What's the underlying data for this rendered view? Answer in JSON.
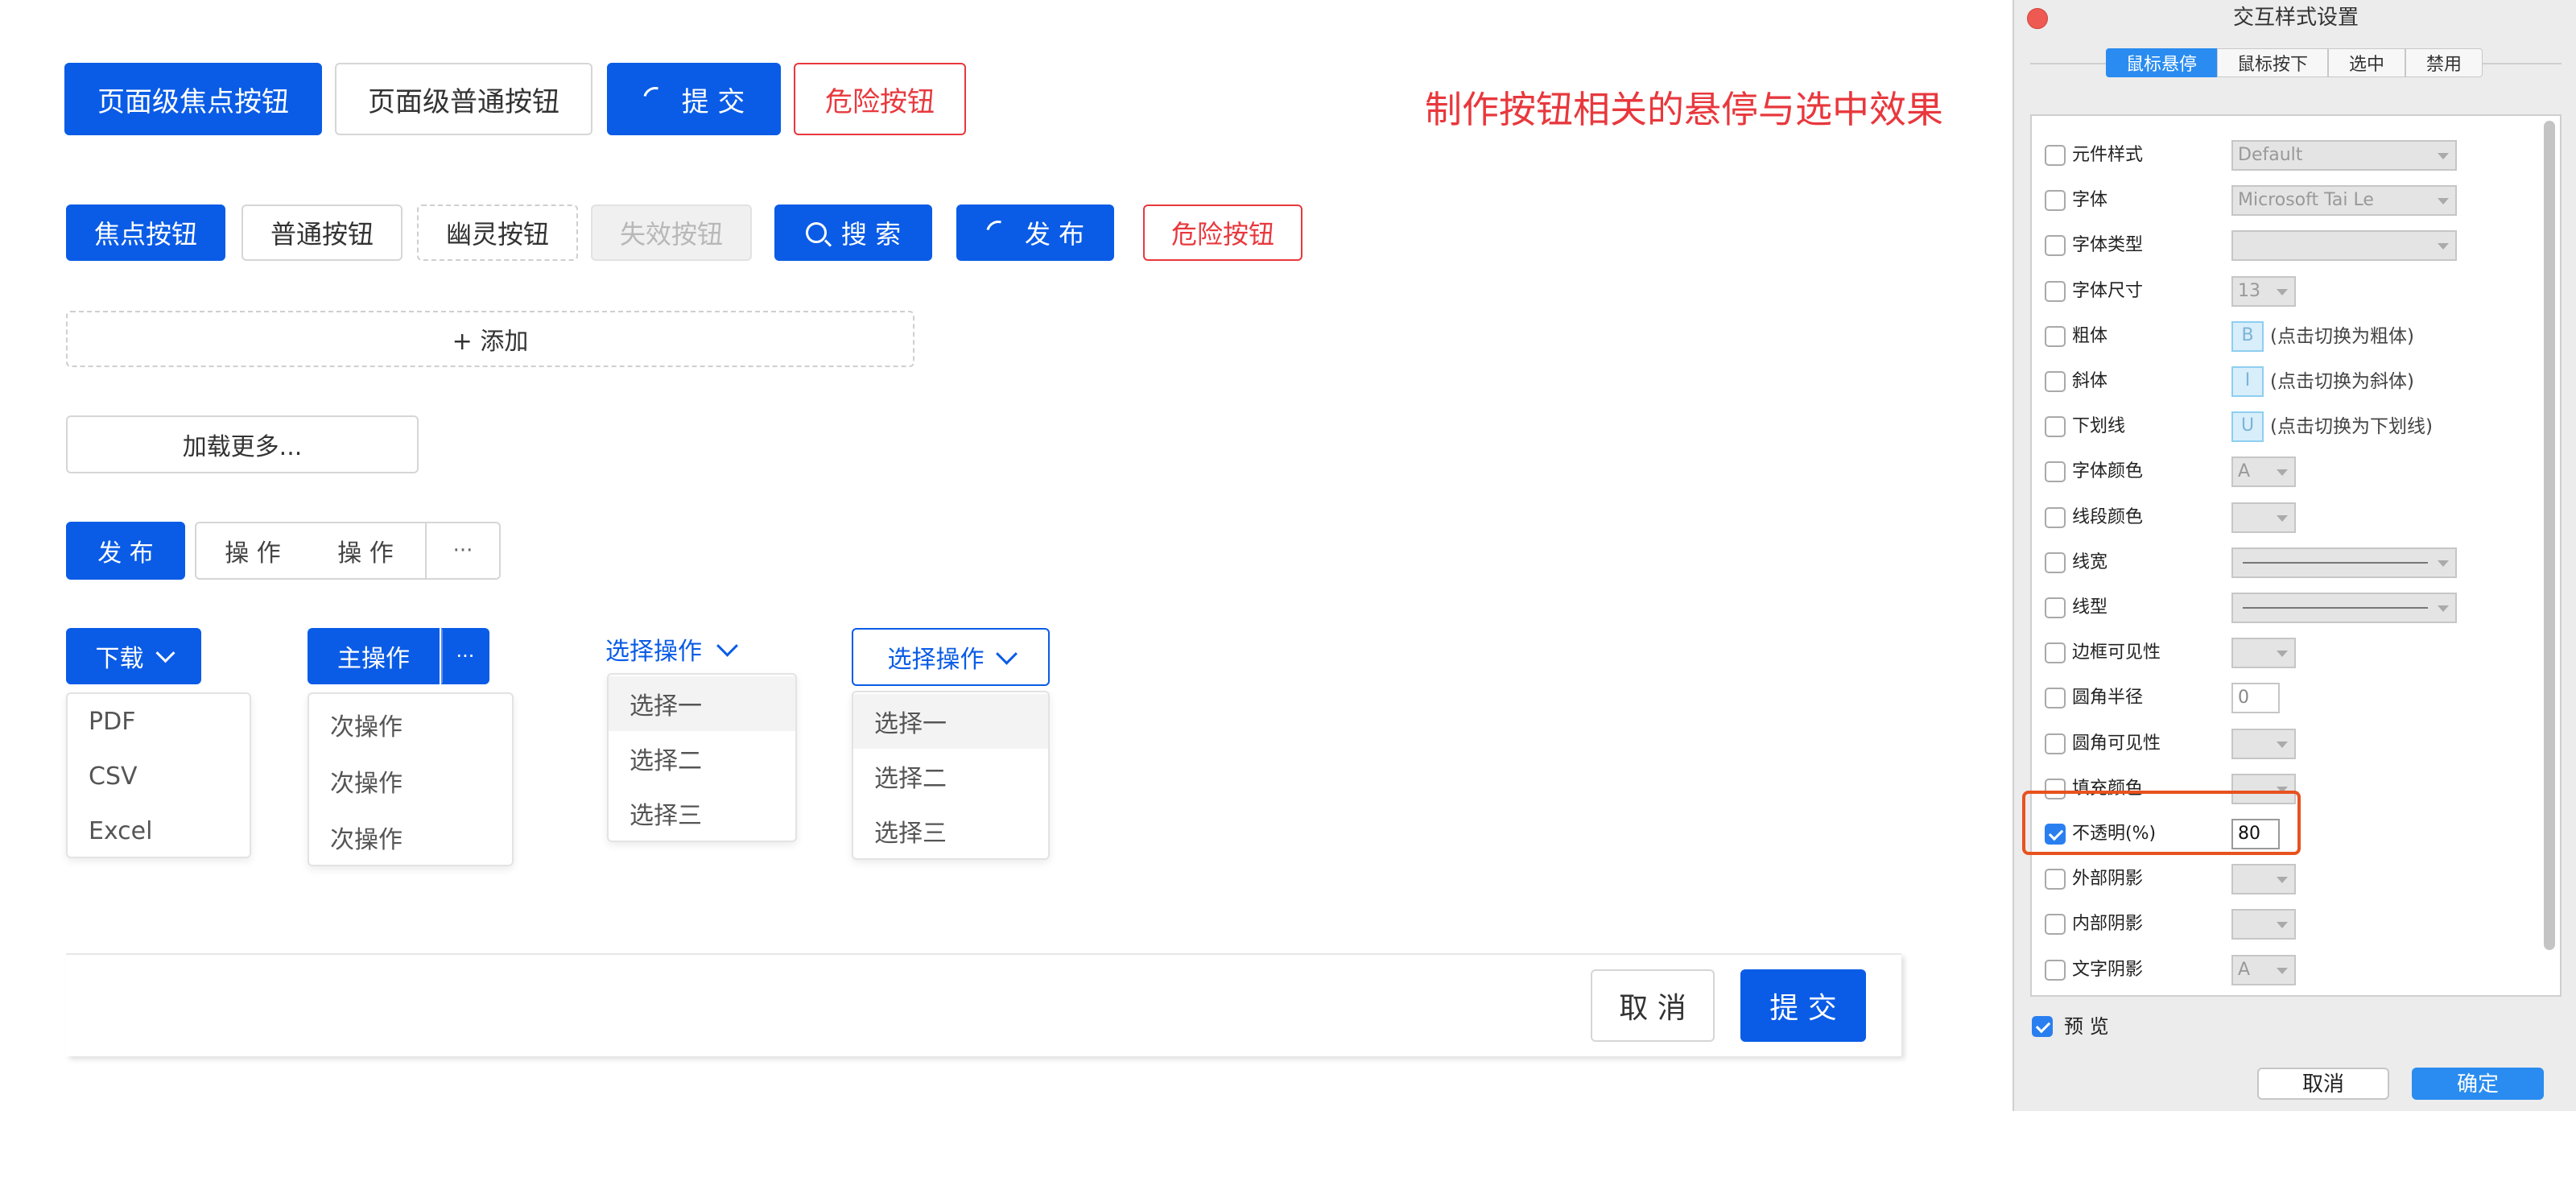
{
  "annotation": "制作按钮相关的悬停与选中效果",
  "row1": {
    "focus_page": "页面级焦点按钮",
    "normal_page": "页面级普通按钮",
    "submit": "提 交",
    "danger": "危险按钮"
  },
  "row2": {
    "focus": "焦点按钮",
    "normal": "普通按钮",
    "ghost": "幽灵按钮",
    "disabled": "失效按钮",
    "search": "搜 索",
    "publish": "发 布",
    "danger": "危险按钮"
  },
  "add_button": "+ 添加",
  "load_more": "加载更多...",
  "group": {
    "publish": "发 布",
    "op1": "操 作",
    "op2": "操 作",
    "more": "···"
  },
  "download": {
    "label": "下载",
    "items": [
      "PDF",
      "CSV",
      "Excel"
    ]
  },
  "split": {
    "main": "主操作",
    "more": "···",
    "items": [
      "次操作",
      "次操作",
      "次操作"
    ]
  },
  "select_text": {
    "label": "选择操作",
    "items": [
      "选择一",
      "选择二",
      "选择三"
    ]
  },
  "select_outline": {
    "label": "选择操作",
    "items": [
      "选择一",
      "选择二",
      "选择三"
    ]
  },
  "footer": {
    "cancel": "取 消",
    "submit": "提 交"
  },
  "panel": {
    "title": "交互样式设置",
    "tabs": [
      "鼠标悬停",
      "鼠标按下",
      "选中",
      "禁用"
    ],
    "active_tab": "鼠标悬停",
    "rows": [
      {
        "label": "元件样式",
        "value": "Default"
      },
      {
        "label": "字体",
        "value": "Microsoft Tai Le"
      },
      {
        "label": "字体类型",
        "value": ""
      },
      {
        "label": "字体尺寸",
        "value": "13"
      },
      {
        "label": "粗体",
        "value": "B",
        "note": "(点击切换为粗体)"
      },
      {
        "label": "斜体",
        "value": "I",
        "note": "(点击切换为斜体)"
      },
      {
        "label": "下划线",
        "value": "U",
        "note": "(点击切换为下划线)"
      },
      {
        "label": "字体颜色",
        "value": "A"
      },
      {
        "label": "线段颜色",
        "value": ""
      },
      {
        "label": "线宽",
        "value": ""
      },
      {
        "label": "线型",
        "value": ""
      },
      {
        "label": "边框可见性",
        "value": ""
      },
      {
        "label": "圆角半径",
        "value": "0"
      },
      {
        "label": "圆角可见性",
        "value": ""
      },
      {
        "label": "填充颜色",
        "value": ""
      },
      {
        "label": "不透明(%)",
        "value": "80",
        "checked": true
      },
      {
        "label": "外部阴影",
        "value": ""
      },
      {
        "label": "内部阴影",
        "value": ""
      },
      {
        "label": "文字阴影",
        "value": "A"
      }
    ],
    "preview_label": "预 览",
    "cancel": "取消",
    "ok": "确定"
  },
  "colors": {
    "primary": "#0a5ce6",
    "danger": "#e8383d",
    "highlight": "#e8521e"
  }
}
